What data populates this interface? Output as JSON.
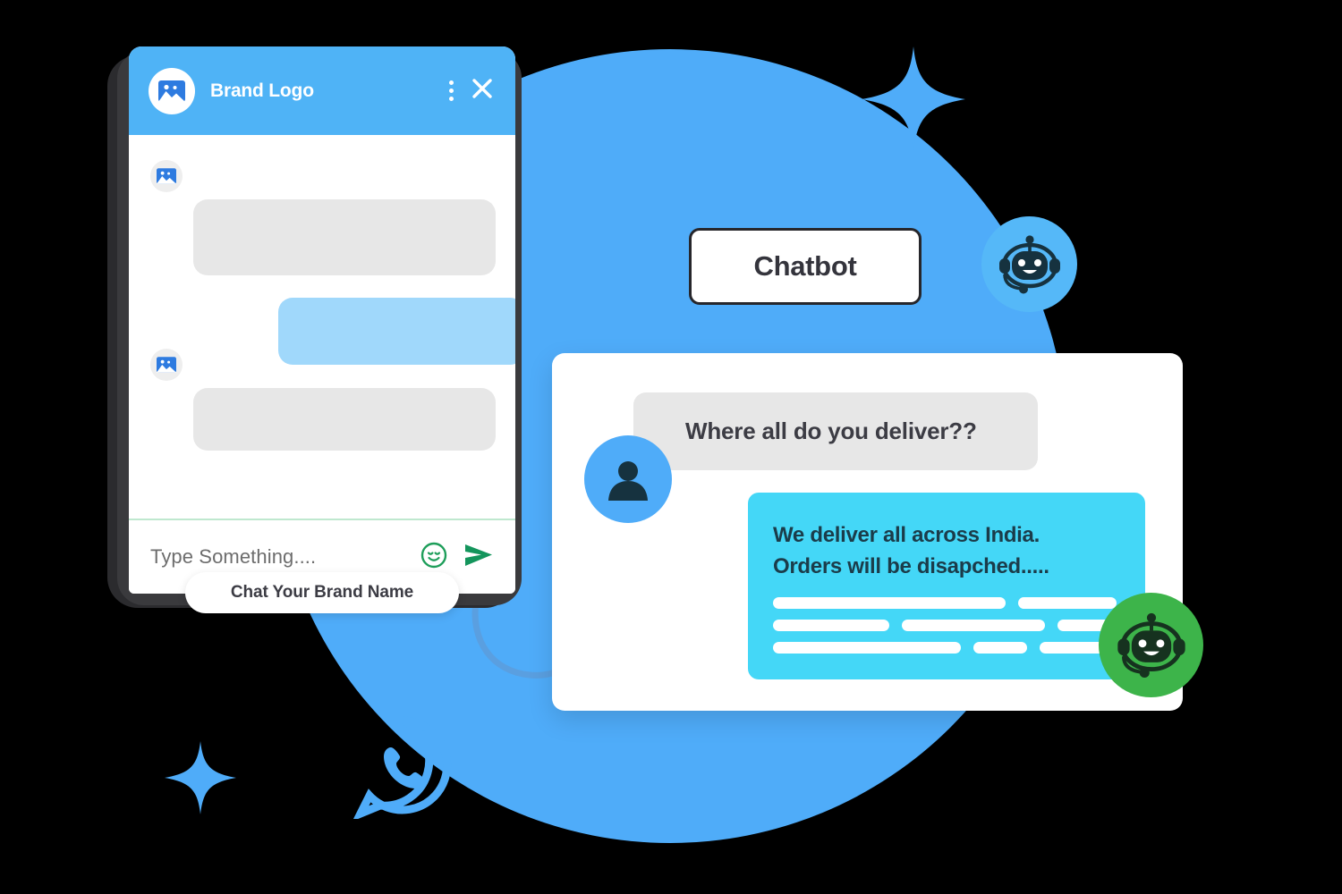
{
  "colors": {
    "brand_blue": "#4FACF9",
    "header_blue": "#4FB3F6",
    "cyan_bubble": "#44D7F7",
    "light_blue_bubble": "#A0D8FB",
    "gray_bubble": "#E7E7E7",
    "green_accent": "#1E9E5A",
    "green_badge": "#3DB44A",
    "dark_text": "#3C3C44",
    "background": "#000000"
  },
  "phone_widget": {
    "header": {
      "brand_title": "Brand Logo",
      "avatar_icon": "image-placeholder-icon",
      "menu_icon": "kebab-menu-icon",
      "close_icon": "close-icon"
    },
    "messages": [
      {
        "type": "incoming",
        "avatar_icon": "image-placeholder-icon",
        "placeholder": true
      },
      {
        "type": "outgoing",
        "placeholder": true
      },
      {
        "type": "incoming",
        "avatar_icon": "image-placeholder-icon",
        "placeholder": true
      }
    ],
    "input": {
      "placeholder": "Type Something....",
      "value": "",
      "emoji_icon": "smiley-icon",
      "send_icon": "send-arrow-icon"
    },
    "chat_pill_label": "Chat Your Brand Name"
  },
  "chatbot_label": {
    "text": "Chatbot",
    "badge_icon": "robot-headset-icon"
  },
  "conversation": {
    "user_avatar_icon": "user-avatar-icon",
    "question": "Where all do you deliver??",
    "answer_lines": [
      "We deliver all across India.",
      "Orders will be disapched....."
    ],
    "answer_placeholder_rows": [
      [
        260,
        110
      ],
      [
        130,
        160,
        70
      ],
      [
        210,
        60,
        100
      ]
    ],
    "bot_badge_icon": "robot-headset-icon"
  },
  "decorations": {
    "background_circle": "large-blue-circle",
    "sparkles": [
      "sparkle-icon-large",
      "sparkle-icon-small"
    ],
    "phone_bubble": "whatsapp-phone-bubble-icon",
    "curved_arrow": "curved-arrow-icon"
  }
}
